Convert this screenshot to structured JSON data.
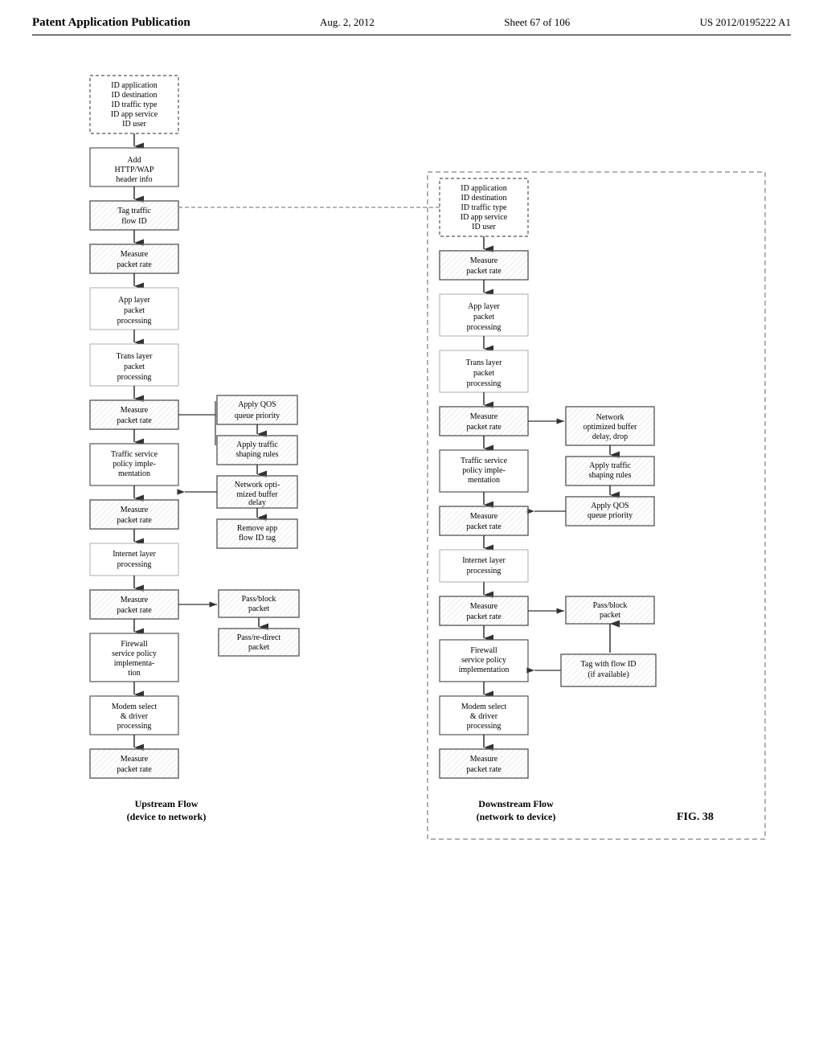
{
  "header": {
    "left": "Patent Application Publication",
    "center": "Aug. 2, 2012",
    "sheet": "Sheet 67 of 106",
    "patent": "US 2012/0195222 A1"
  },
  "figure": {
    "label": "FIG. 38",
    "upstream_label": "Upstream Flow\n(device to network)",
    "downstream_label": "Downstream Flow\n(network to device)"
  },
  "upstream": {
    "boxes": [
      {
        "id": "u1",
        "text": "ID application\nID destination\nID traffic type\nID app service\nID user",
        "type": "dotted"
      },
      {
        "id": "u2",
        "text": "Add\nHTTP/WAP\nheader info",
        "type": "normal"
      },
      {
        "id": "u3",
        "text": "Tag traffic\nflow ID",
        "type": "hatched"
      },
      {
        "id": "u4",
        "text": "Measure\npacket rate",
        "type": "hatched"
      },
      {
        "id": "u5",
        "text": "App layer\npacket\nprocessing",
        "type": "plain"
      },
      {
        "id": "u6",
        "text": "Trans layer\npacket\nprocessing",
        "type": "plain"
      },
      {
        "id": "u7",
        "text": "Measure\npacket rate",
        "type": "hatched"
      },
      {
        "id": "u8",
        "text": "Traffic service\npolicy imple-\nmentation",
        "type": "normal"
      },
      {
        "id": "u9",
        "text": "Measure\npacket rate",
        "type": "hatched"
      },
      {
        "id": "u10",
        "text": "Internet layer\nprocessing",
        "type": "plain"
      },
      {
        "id": "u11",
        "text": "Measure\npacket rate",
        "type": "hatched"
      },
      {
        "id": "u12",
        "text": "Firewall\nservice policy\nimplementa-\ntion",
        "type": "normal"
      },
      {
        "id": "u13",
        "text": "Modem select\n& driver\nprocessing",
        "type": "normal"
      },
      {
        "id": "u14",
        "text": "Measure\npacket rate",
        "type": "hatched"
      }
    ],
    "side_boxes": [
      {
        "id": "us1",
        "text": "Apply QOS\nqueue priority",
        "type": "hatched"
      },
      {
        "id": "us2",
        "text": "Apply traffic\nshaping rules",
        "type": "hatched"
      },
      {
        "id": "us3",
        "text": "Network opti-\nmized buffer\ndelay",
        "type": "hatched"
      },
      {
        "id": "us4",
        "text": "Remove app\nflow ID tag",
        "type": "hatched"
      },
      {
        "id": "us5",
        "text": "Pass/block\npacket",
        "type": "hatched"
      },
      {
        "id": "us6",
        "text": "Pass/re-direct\npacket",
        "type": "hatched"
      }
    ]
  },
  "downstream": {
    "boxes": [
      {
        "id": "d1",
        "text": "ID application\nID destination\nID traffic type\nID app service\nID user",
        "type": "dotted"
      },
      {
        "id": "d2",
        "text": "Measure\npacket rate",
        "type": "hatched"
      },
      {
        "id": "d3",
        "text": "App layer\npacket\nprocessing",
        "type": "plain"
      },
      {
        "id": "d4",
        "text": "Trans layer\npacket\nprocessing",
        "type": "plain"
      },
      {
        "id": "d5",
        "text": "Measure\npacket rate",
        "type": "hatched"
      },
      {
        "id": "d6",
        "text": "Traffic service\npolicy imple-\nmentation",
        "type": "normal"
      },
      {
        "id": "d7",
        "text": "Measure\npacket rate",
        "type": "hatched"
      },
      {
        "id": "d8",
        "text": "Internet layer\nprocessing",
        "type": "plain"
      },
      {
        "id": "d9",
        "text": "Measure\npacket rate",
        "type": "hatched"
      },
      {
        "id": "d10",
        "text": "Firewall\nservice policy\nimplementation",
        "type": "normal"
      },
      {
        "id": "d11",
        "text": "Modem select\n& driver\nprocessing",
        "type": "normal"
      },
      {
        "id": "d12",
        "text": "Measure\npacket rate",
        "type": "hatched"
      }
    ],
    "side_boxes": [
      {
        "id": "ds1",
        "text": "Network\noptimized buffer\ndelay, drop",
        "type": "hatched"
      },
      {
        "id": "ds2",
        "text": "Apply traffic\nshaping rules",
        "type": "hatched"
      },
      {
        "id": "ds3",
        "text": "Apply QOS\nqueue priority",
        "type": "hatched"
      },
      {
        "id": "ds4",
        "text": "Pass/block\npacket",
        "type": "hatched"
      },
      {
        "id": "ds5",
        "text": "Tag with flow ID\n(if available)",
        "type": "hatched"
      }
    ]
  }
}
